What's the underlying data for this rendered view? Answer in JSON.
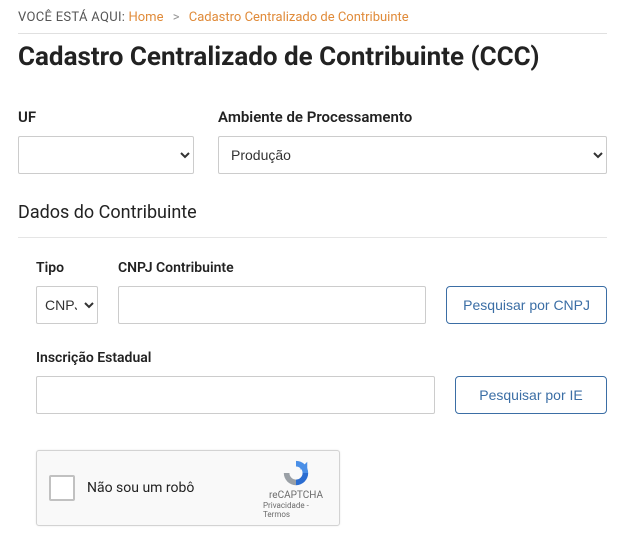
{
  "breadcrumb": {
    "prefix": "VOCÊ ESTÁ AQUI:",
    "home": "Home",
    "sep": ">",
    "current": "Cadastro Centralizado de Contribuinte"
  },
  "page_title": "Cadastro Centralizado de Contribuinte (CCC)",
  "fields": {
    "uf_label": "UF",
    "uf_value": "",
    "ambiente_label": "Ambiente de Processamento",
    "ambiente_value": "Produção"
  },
  "section_heading": "Dados do Contribuinte",
  "contrib": {
    "tipo_label": "Tipo",
    "tipo_value": "CNPJ",
    "cnpj_label": "CNPJ Contribuinte",
    "cnpj_value": "",
    "btn_cnpj": "Pesquisar por CNPJ",
    "ie_label": "Inscrição Estadual",
    "ie_value": "",
    "btn_ie": "Pesquisar por IE"
  },
  "recaptcha": {
    "label": "Não sou um robô",
    "brand": "reCAPTCHA",
    "privacy": "Privacidade",
    "dash": " - ",
    "terms": "Termos"
  }
}
